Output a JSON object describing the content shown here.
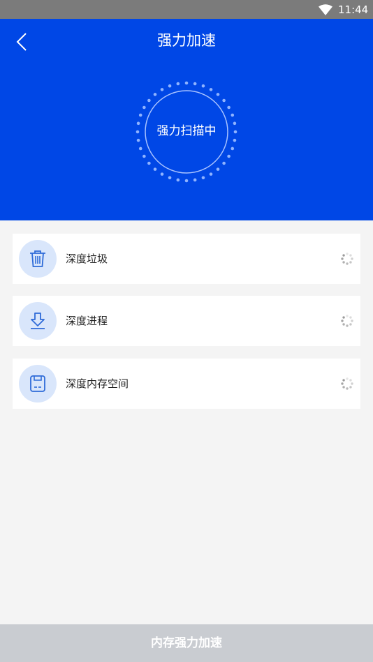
{
  "status_bar": {
    "time": "11:44",
    "wifi_icon": "wifi-icon"
  },
  "header": {
    "title": "强力加速",
    "back_icon": "chevron-left-icon",
    "background_color": "#0047e6"
  },
  "scan": {
    "status_text": "强力扫描中"
  },
  "scan_items": [
    {
      "label": "深度垃圾",
      "icon": "trash-icon",
      "status_icon": "loading-spinner-icon"
    },
    {
      "label": "深度进程",
      "icon": "download-icon",
      "status_icon": "loading-spinner-icon"
    },
    {
      "label": "深度内存空间",
      "icon": "memory-card-icon",
      "status_icon": "loading-spinner-icon"
    }
  ],
  "footer": {
    "button_label": "内存强力加速"
  }
}
